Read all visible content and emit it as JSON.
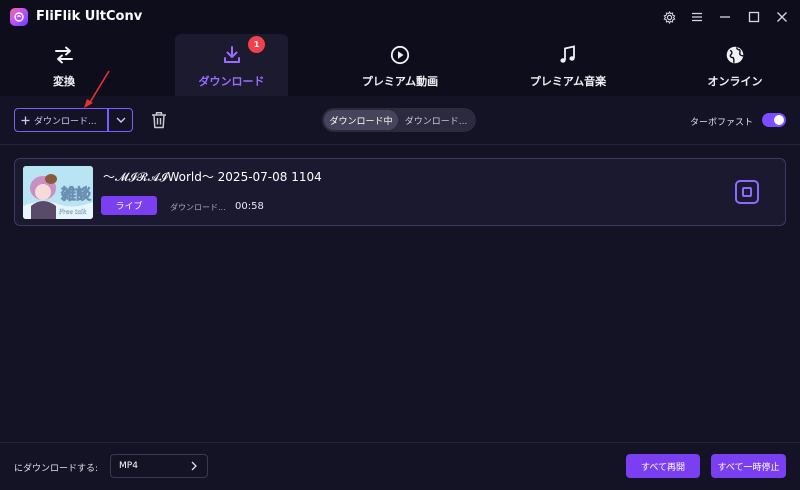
{
  "window": {
    "title": "FliFlik UltConv",
    "controls": [
      "gear-icon",
      "menu-icon",
      "minimize-icon",
      "maximize-icon",
      "close-icon"
    ]
  },
  "nav": {
    "tabs": [
      {
        "label": "変換",
        "icon": "convert-arrows-icon",
        "active": false
      },
      {
        "label": "ダウンロード",
        "icon": "download-icon",
        "active": true,
        "badge": "1"
      },
      {
        "label": "プレミアム動画",
        "icon": "play-circle-icon",
        "active": false
      },
      {
        "label": "プレミアム音楽",
        "icon": "music-note-icon",
        "active": false
      },
      {
        "label": "オンライン",
        "icon": "globe-icon",
        "active": false
      }
    ]
  },
  "toolbar": {
    "download_button": "ダウンロード...",
    "segments": {
      "active": "ダウンロード中",
      "inactive": "ダウンロード..."
    },
    "turbo_label": "ターボファスト",
    "turbo_on": true
  },
  "downloads": [
    {
      "title": "〜𝓜𝓘𝓡𝓐𝓘World〜 2025-07-08 1104",
      "badge": "ライブ",
      "status": "ダウンロード...",
      "elapsed": "00:58",
      "thumbnail_text": "雑談"
    }
  ],
  "footer": {
    "format_label": "にダウンロードする:",
    "format_value": "MP4",
    "resume_all": "すべて再開",
    "pause_all": "すべて一時停止"
  },
  "colors": {
    "accent": "#7b3ff2",
    "accent_light": "#9b6bff",
    "background": "#0e0d1c",
    "panel": "#141325",
    "badge_red": "#f0414d"
  }
}
